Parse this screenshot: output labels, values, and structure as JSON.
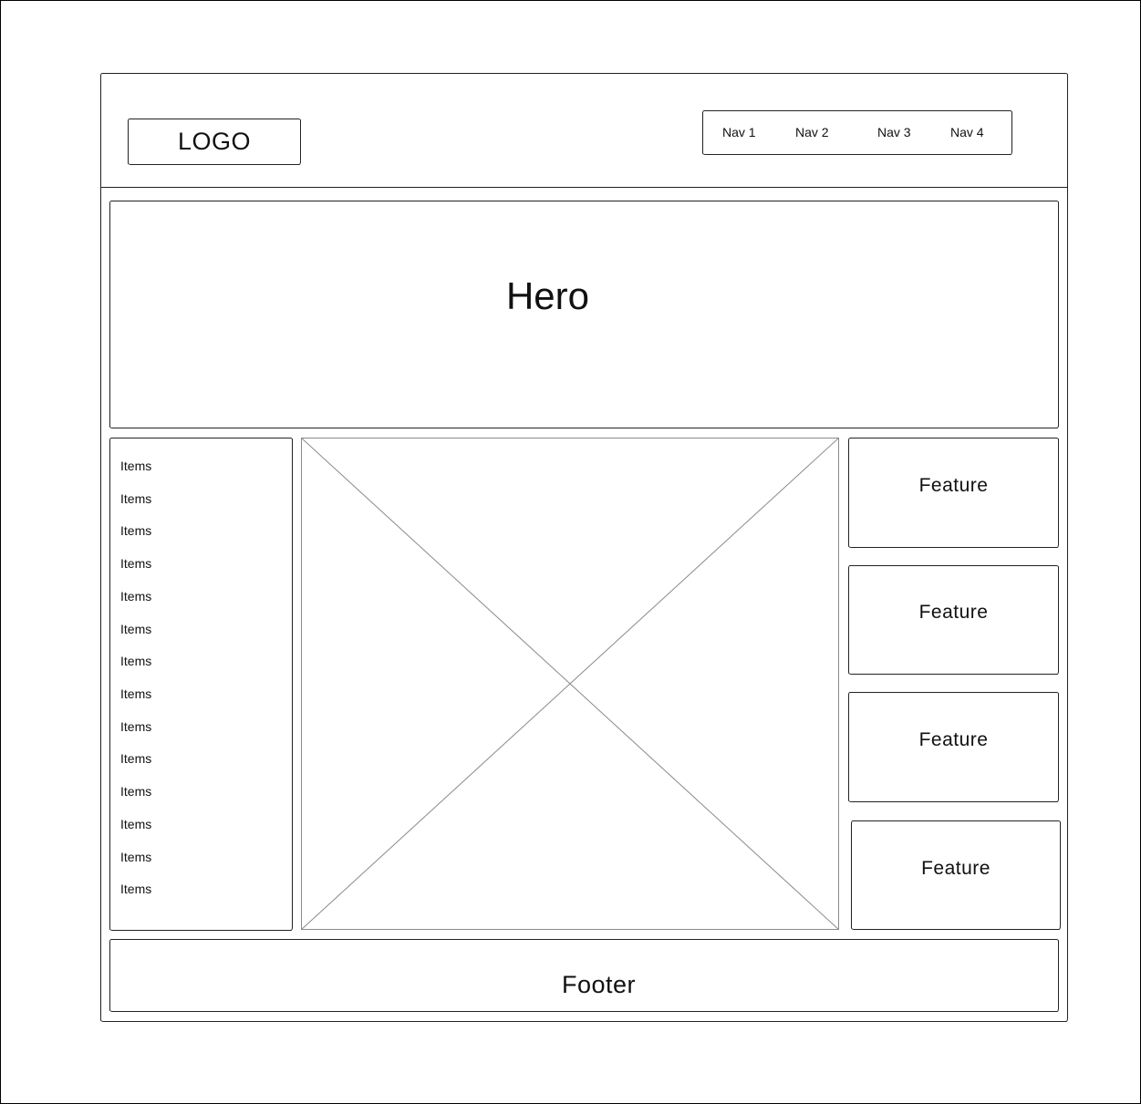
{
  "header": {
    "logo": "LOGO",
    "nav": [
      "Nav 1",
      "Nav 2",
      "Nav 3",
      "Nav 4"
    ]
  },
  "hero": {
    "title": "Hero"
  },
  "sidebar": {
    "items": [
      "Items",
      "Items",
      "Items",
      "Items",
      "Items",
      "Items",
      "Items",
      "Items",
      "Items",
      "Items",
      "Items",
      "Items",
      "Items",
      "Items"
    ]
  },
  "features": [
    "Feature",
    "Feature",
    "Feature",
    "Feature"
  ],
  "footer": {
    "text": "Footer"
  },
  "icons": {
    "main_image": "image-placeholder-icon"
  },
  "colors": {
    "stroke": "#222222",
    "placeholder_stroke": "#8a8a8a",
    "background": "#ffffff"
  }
}
